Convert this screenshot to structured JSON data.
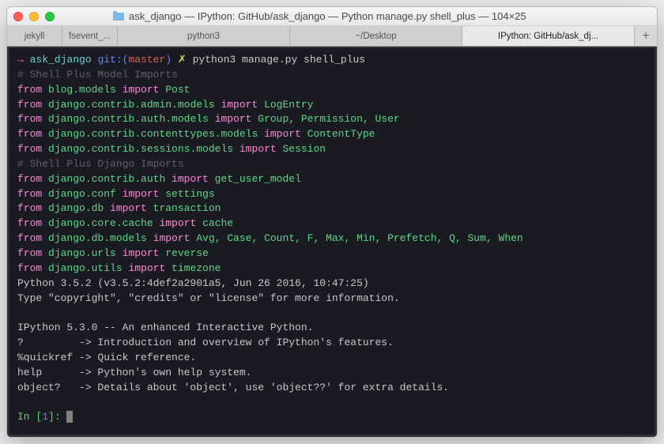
{
  "window": {
    "title": "ask_django — IPython: GitHub/ask_django — Python manage.py shell_plus — 104×25"
  },
  "tabs": [
    {
      "label": "jekyll"
    },
    {
      "label": "fsevent_..."
    },
    {
      "label": "python3"
    },
    {
      "label": "~/Desktop"
    },
    {
      "label": "IPython: GitHub/ask_dj..."
    }
  ],
  "tabPlus": "+",
  "prompt": {
    "arrow": "→",
    "dir": "ask_django",
    "git_left": "git:(",
    "branch": "master",
    "git_right": ")",
    "x": "✗",
    "cmd": "python3 manage.py shell_plus"
  },
  "lines": {
    "c1": "# Shell Plus Model Imports",
    "l1a": "from ",
    "l1b": "blog.models ",
    "l1c": "import ",
    "l1d": "Post",
    "l2a": "from ",
    "l2b": "django.contrib.admin.models ",
    "l2c": "import ",
    "l2d": "LogEntry",
    "l3a": "from ",
    "l3b": "django.contrib.auth.models ",
    "l3c": "import ",
    "l3d": "Group, Permission, User",
    "l4a": "from ",
    "l4b": "django.contrib.contenttypes.models ",
    "l4c": "import ",
    "l4d": "ContentType",
    "l5a": "from ",
    "l5b": "django.contrib.sessions.models ",
    "l5c": "import ",
    "l5d": "Session",
    "c2": "# Shell Plus Django Imports",
    "l6a": "from ",
    "l6b": "django.contrib.auth ",
    "l6c": "import ",
    "l6d": "get_user_model",
    "l7a": "from ",
    "l7b": "django.conf ",
    "l7c": "import ",
    "l7d": "settings",
    "l8a": "from ",
    "l8b": "django.db ",
    "l8c": "import ",
    "l8d": "transaction",
    "l9a": "from ",
    "l9b": "django.core.cache ",
    "l9c": "import ",
    "l9d": "cache",
    "l10a": "from ",
    "l10b": "django.db.models ",
    "l10c": "import ",
    "l10d": "Avg, Case, Count, F, Max, Min, Prefetch, Q, Sum, When",
    "l11a": "from ",
    "l11b": "django.urls ",
    "l11c": "import ",
    "l11d": "reverse",
    "l12a": "from ",
    "l12b": "django.utils ",
    "l12c": "import ",
    "l12d": "timezone",
    "py1": "Python 3.5.2 (v3.5.2:4def2a2901a5, Jun 26 2016, 10:47:25)",
    "py2": "Type \"copyright\", \"credits\" or \"license\" for more information.",
    "ip1": "IPython 5.3.0 -- An enhanced Interactive Python.",
    "ip2": "?         -> Introduction and overview of IPython's features.",
    "ip3": "%quickref -> Quick reference.",
    "ip4": "help      -> Python's own help system.",
    "ip5": "object?   -> Details about 'object', use 'object??' for extra details.",
    "in_label": "In ",
    "in_open": "[",
    "in_num": "1",
    "in_close": "]: "
  }
}
